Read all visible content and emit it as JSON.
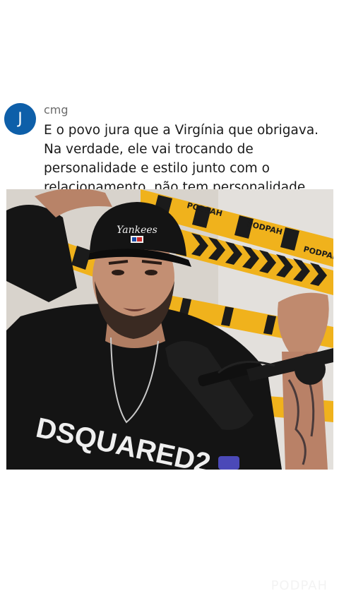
{
  "comment": {
    "avatar_letter": "J",
    "avatar_color": "#0e5fa9",
    "username": "cmg",
    "text": "E o povo jura que a Virgínia que obrigava. Na verdade, ele vai trocando de personalidade e estilo junto com o relacionamento, não tem personalidade nenhuma."
  },
  "video": {
    "cap_logo": "Yankees",
    "shirt_text": "DSQUARED2",
    "tape_text": "PODPAH",
    "tape_color": "#f0b21c"
  },
  "watermark": "PODPAH"
}
